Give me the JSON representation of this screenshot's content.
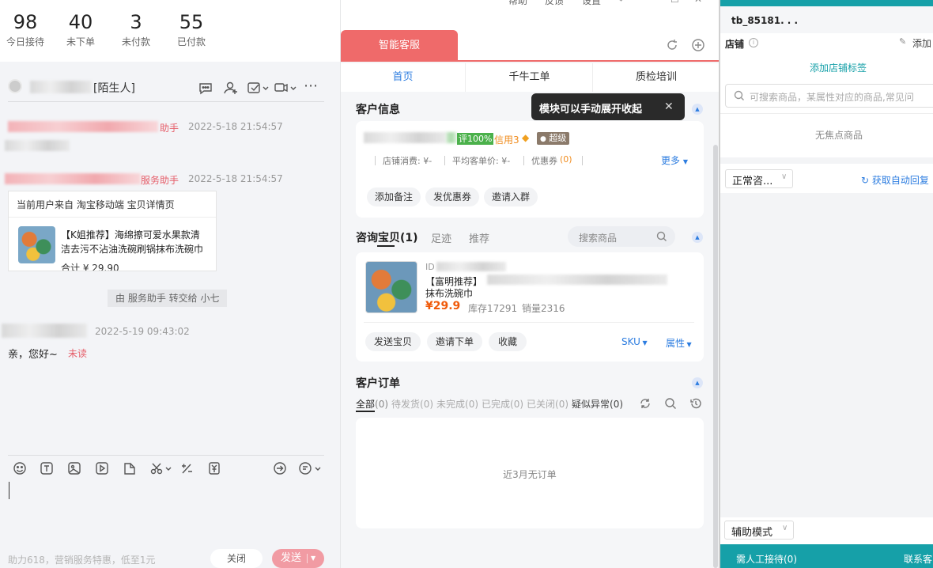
{
  "stats": [
    {
      "value": "98",
      "label": "今日接待"
    },
    {
      "value": "40",
      "label": "未下单"
    },
    {
      "value": "3",
      "label": "未付款"
    },
    {
      "value": "55",
      "label": "已付款"
    }
  ],
  "window_menu": [
    "帮助",
    "反馈",
    "设置"
  ],
  "chat": {
    "header_suffix": "[陌生人]",
    "msg1": {
      "name_tail": "助手",
      "time": "2022-5-18 21:54:57"
    },
    "msg2": {
      "name_tail": "服务助手",
      "time": "2022-5-18 21:54:57"
    },
    "source_text": "当前用户来自 淘宝移动端 宝贝详情页",
    "product_title": "【K姐推荐】海绵擦可爱水果款清洁去污不沾油洗碗刷锅抹布洗碗巾",
    "product_total": "合计 ¥ 29.90",
    "transfer_notice": "由 服务助手 转交给 小七",
    "msg3": {
      "time": "2022-5-19 09:43:02",
      "text": "亲，您好~",
      "status": "未读"
    },
    "footer_hint": "助力618，营销服务特惠，低至1元",
    "close_label": "关闭",
    "send_label": "发送"
  },
  "mid": {
    "tab_label": "智能客服",
    "subtabs": [
      "首页",
      "千牛工单",
      "质检培训"
    ],
    "customer_info": {
      "title": "客户信息",
      "tooltip": "模块可以手动展开收起",
      "rating": "评100%",
      "credit": "信用3",
      "vip": "超级",
      "store_spend": "店铺消费: ¥-",
      "avg_price": "平均客单价: ¥-",
      "coupon_label": "优惠券",
      "coupon_val": "(0)",
      "more": "更多",
      "actions": [
        "添加备注",
        "发优惠券",
        "邀请入群"
      ]
    },
    "consult": {
      "tabs": [
        "咨询宝贝(1)",
        "足迹",
        "推荐"
      ],
      "search_placeholder": "搜索商品",
      "id_prefix": "ID",
      "title_head": "【富明推荐】",
      "title_tail": "抹布洗碗巾",
      "price": "¥29.9",
      "stock": "库存17291",
      "sales": "销量2316",
      "actions": [
        "发送宝贝",
        "邀请下单",
        "收藏"
      ],
      "sku": "SKU",
      "attr": "属性"
    },
    "orders": {
      "title": "客户订单",
      "filters": [
        {
          "label": "全部",
          "count": "(0)"
        },
        {
          "label": "待发货",
          "count": "(0)"
        },
        {
          "label": "未完成",
          "count": "(0)"
        },
        {
          "label": "已完成",
          "count": "(0)"
        },
        {
          "label": "已关闭",
          "count": "(0)"
        },
        {
          "label": "疑似异常",
          "count": "(0)"
        }
      ],
      "empty": "近3月无订单"
    }
  },
  "right": {
    "username": "tb_85181. . .",
    "store_label": "店铺",
    "add_label": "添加",
    "add_tag": "添加店铺标签",
    "search_placeholder": "可搜索商品，某属性对应的商品,常见问",
    "no_focus": "无焦点商品",
    "mode_select": "正常咨...",
    "auto_reply": "获取自动回复",
    "assist_mode": "辅助模式",
    "human_queue": "需人工接待(0)",
    "contact": "联系客"
  }
}
